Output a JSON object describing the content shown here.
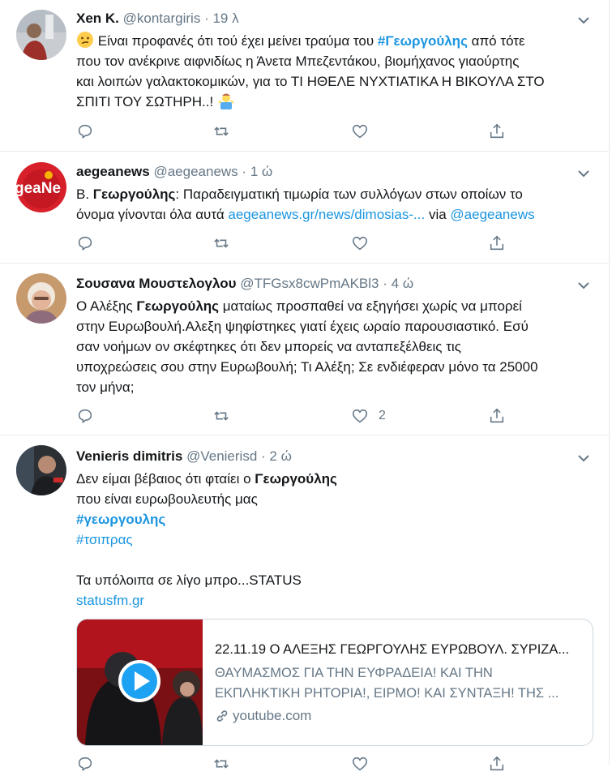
{
  "tweets": [
    {
      "name": "Χen Κ.",
      "handle": "@kontargiris",
      "separator": "·",
      "time": "19 λ",
      "text_lines": [
        [
          "Είναι προφανές ότι τού έχει μείνει τραύμα του ",
          "#Γεωργούλης",
          " από τότε"
        ],
        [
          "που τον ανέκρινε αιφνιδίως η Άνετα Μπεζεντάκου, βιομήχανος γιαούρτης"
        ],
        [
          "και λοιπών γαλακτοκομικών, για το ΤΙ ΗΘΕΛΕ ΝΥΧΤΙΑΤΙΚΑ Η ΒΙΚΟΥΛΑ ΣΤΟ"
        ],
        [
          "ΣΠΙΤΙ ΤΟΥ ΣΩΤΗΡΗ..!"
        ]
      ],
      "emojis": [
        "confused-face",
        "man-shrugging"
      ]
    },
    {
      "name": "aegeanews",
      "handle": "@aegeanews",
      "separator": "·",
      "time": "1 ώ",
      "text_lines": [
        [
          "Β. ",
          "Γεωργούλης",
          ": Παραδειγματική τιμωρία των συλλόγων στων οποίων το"
        ],
        [
          "όνομα γίνονται όλα αυτά ",
          "aegeanews.gr/news/dimosias-...",
          " via ",
          "@aegeanews"
        ]
      ]
    },
    {
      "name": "Σουσανα Μουστελογλου",
      "handle": "@TFGsx8cwPmAKBl3",
      "separator": "·",
      "time": "4 ώ",
      "text_lines": [
        [
          "Ο Αλέξης ",
          "Γεωργούλης",
          " ματαίως προσπαθεί να εξηγήσει χωρίς να μπορεί"
        ],
        [
          "στην Ευρωβουλή.Αλεξη ψηφίστηκες  γιατί έχεις ωραίο παρουσιαστικό. Εσύ"
        ],
        [
          "σαν νοήμων ον σκέφτηκες ότι δεν μπορείς να ανταπεξέλθεις τις"
        ],
        [
          "υποχρεώσεις σου στην Ευρωβουλή; Τι Αλέξη; Σε ενδιέφεραν μόνο τα 25000"
        ],
        [
          "τον μήνα;"
        ]
      ],
      "like_count": "2"
    },
    {
      "name": "Venieris dimitris",
      "handle": "@Venierisd",
      "separator": "·",
      "time": "2 ώ",
      "text_lines": [
        [
          "Δεν είμαι βέβαιος ότι φταίει ο ",
          "Γεωργούλης"
        ],
        [
          "που είναι ευρωβουλευτής μας"
        ],
        [
          "#γεωργουλης"
        ],
        [
          "#τσιπρας"
        ],
        [
          ""
        ],
        [
          "Τα υπόλοιπα  σε λίγο μπρο...STATUS"
        ],
        [
          "statusfm.gr"
        ]
      ],
      "card": {
        "title": "22.11.19 Ο ΑΛΕΞΗΣ ΓΕΩΡΓΟΥΛΗΣ ΕΥΡΩΒΟΥΛ. ΣΥΡΙΖΑ...",
        "desc_lines": [
          "ΘΑΥΜΑΣΜΟΣ ΓΙΑ ΤΗΝ ΕΥΦΡΑΔΕΙΑ! ΚΑΙ ΤΗΝ",
          "ΕΚΠΛΗΚΤΙΚΗ ΡΗΤΟΡΙΑ!, ΕΙΡΜΟ! ΚΑΙ ΣΥΝΤΑΞΗ! ΤΗΣ ..."
        ],
        "domain": "youtube.com"
      }
    }
  ],
  "icons": {
    "reply": "reply-icon",
    "retweet": "retweet-icon",
    "like": "heart-icon",
    "share": "share-icon",
    "menu": "chevron-down-icon",
    "play": "play-icon",
    "link": "link-icon"
  },
  "colors": {
    "link": "#1b95e0",
    "secondary_text": "#657786",
    "divider": "#e6ecf0",
    "play_button": "#1da1f2"
  }
}
